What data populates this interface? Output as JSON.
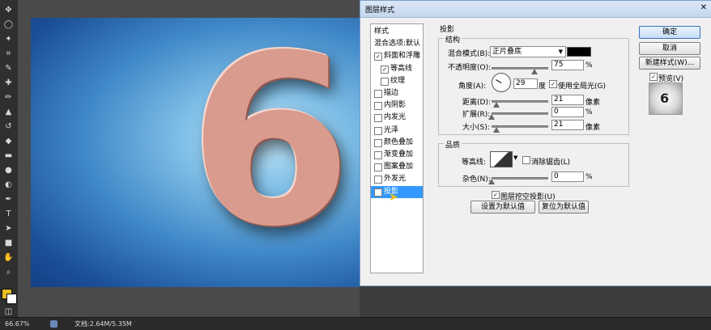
{
  "dialog": {
    "title": "图层样式",
    "close": "✕",
    "list": [
      {
        "label": "样式",
        "type": "head"
      },
      {
        "label": "混合选项:默认",
        "type": "head"
      },
      {
        "label": "斜面和浮雕",
        "checked": true
      },
      {
        "label": "等高线",
        "checked": true,
        "sub": true
      },
      {
        "label": "纹理",
        "checked": false,
        "sub": true
      },
      {
        "label": "描边",
        "checked": false
      },
      {
        "label": "内阴影",
        "checked": false
      },
      {
        "label": "内发光",
        "checked": false
      },
      {
        "label": "光泽",
        "checked": false
      },
      {
        "label": "颜色叠加",
        "checked": false
      },
      {
        "label": "渐变叠加",
        "checked": false
      },
      {
        "label": "图案叠加",
        "checked": false
      },
      {
        "label": "外发光",
        "checked": false
      },
      {
        "label": "投影",
        "checked": true,
        "selected": true
      }
    ],
    "section_title": "投影",
    "structure": {
      "title": "结构",
      "blend_mode_label": "混合模式(B):",
      "blend_mode_value": "正片叠底",
      "color": "#000000",
      "opacity_label": "不透明度(O):",
      "opacity_value": "75",
      "opacity_unit": "%",
      "angle_label": "角度(A):",
      "angle_value": "29",
      "angle_unit": "度",
      "global_light_label": "使用全局光(G)",
      "global_light_checked": true,
      "distance_label": "距离(D):",
      "distance_value": "21",
      "distance_unit": "像素",
      "spread_label": "扩展(R):",
      "spread_value": "0",
      "spread_unit": "%",
      "size_label": "大小(S):",
      "size_value": "21",
      "size_unit": "像素"
    },
    "quality": {
      "title": "品质",
      "contour_label": "等高线:",
      "antialias_label": "消除锯齿(L)",
      "antialias_checked": false,
      "noise_label": "杂色(N):",
      "noise_value": "0",
      "noise_unit": "%"
    },
    "knockout_label": "图层挖空投影(U)",
    "knockout_checked": true,
    "make_default": "设置为默认值",
    "reset_default": "复位为默认值",
    "buttons": {
      "ok": "确定",
      "cancel": "取消",
      "new_style": "新建样式(W)...",
      "preview_label": "预览(V)",
      "preview_checked": true
    }
  },
  "canvas": {
    "glyph": "6"
  },
  "status": {
    "zoom": "66.67%",
    "doc": "文档:2.64M/5.35M"
  },
  "sliders": {
    "opacity": 0.75,
    "distance": 0.08,
    "spread": 0.0,
    "size": 0.08,
    "noise": 0.0
  }
}
